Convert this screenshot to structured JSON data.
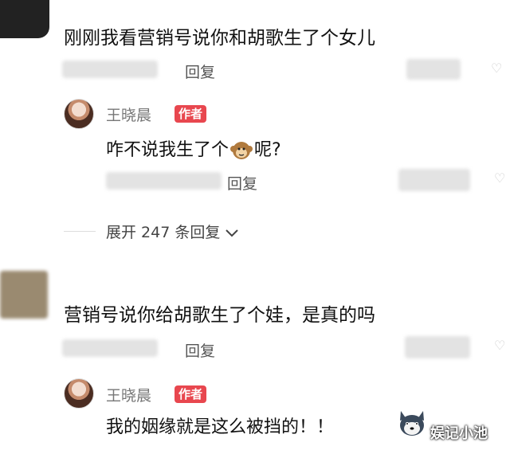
{
  "thread1": {
    "comment_text": "刚刚我看营销号说你和胡歌生了个女儿",
    "reply_label": "回复",
    "author_reply": {
      "name": "王晓晨",
      "badge": "作者",
      "text_before": "咋不说我生了个",
      "emoji": "monkey",
      "text_after": "呢?",
      "reply_label": "回复"
    },
    "expand_label": "展开 247 条回复"
  },
  "thread2": {
    "comment_text": "营销号说你给胡歌生了个娃，是真的吗",
    "reply_label": "回复",
    "author_reply": {
      "name": "王晓晨",
      "badge": "作者",
      "text": "我的姻缘就是这么被挡的！！",
      "emoji": "husky-dog"
    }
  },
  "watermark": "娱记小池",
  "icons": {
    "expand": "chevron-down-icon",
    "like": "heart-icon"
  },
  "colors": {
    "badge": "#e8474f"
  }
}
